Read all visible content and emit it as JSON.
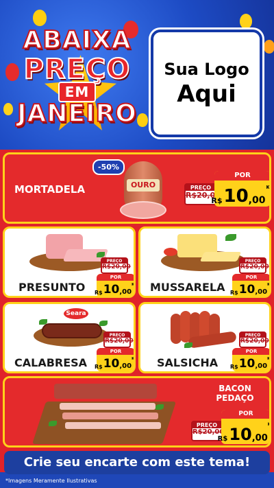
{
  "header": {
    "headline_1": "ABAIXA",
    "headline_2": "PREÇO",
    "headline_3": "EM",
    "headline_4": "JANEIRO",
    "logo_line_1": "Sua Logo",
    "logo_line_2": "Aqui"
  },
  "colors": {
    "brand_blue": "#1d4bc4",
    "brand_red": "#e42a2c",
    "brand_yellow": "#ffd21a"
  },
  "products": {
    "mortadela": {
      "name": "MORTADELA",
      "brand_on_pack": "OURO",
      "discount": "-50%",
      "old_label": "PREÇO",
      "old_price": "R$20,00",
      "new_label": "POR",
      "currency": "R$",
      "price_int": "10",
      "price_cents": ",00",
      "unit": "KG"
    },
    "presunto": {
      "name": "PRESUNTO",
      "old_label": "PREÇO",
      "old_price": "R$20,00",
      "new_label": "POR",
      "currency": "R$",
      "price_int": "10",
      "price_cents": ",00",
      "unit": "KG"
    },
    "mussarela": {
      "name": "MUSSARELA",
      "old_label": "PREÇO",
      "old_price": "R$20,00",
      "new_label": "POR",
      "currency": "R$",
      "price_int": "10",
      "price_cents": ",00",
      "unit": "KG"
    },
    "calabresa": {
      "name": "CALABRESA",
      "brand_on_pack": "Seara",
      "old_label": "PREÇO",
      "old_price": "R$20,00",
      "new_label": "POR",
      "currency": "R$",
      "price_int": "10",
      "price_cents": ",00",
      "unit": "KG"
    },
    "salsicha": {
      "name": "SALSICHA",
      "old_label": "PREÇO",
      "old_price": "R$20,00",
      "new_label": "POR",
      "currency": "R$",
      "price_int": "10",
      "price_cents": ",00",
      "unit": "KG"
    },
    "bacon": {
      "name_line_1": "BACON",
      "name_line_2": "PEDAÇO",
      "old_label": "PREÇO",
      "old_price": "R$20,00",
      "new_label": "POR",
      "currency": "R$",
      "price_int": "10",
      "price_cents": ",00",
      "unit": "KG"
    }
  },
  "footer": {
    "cta": "Crie seu encarte com este tema!",
    "disclaimer": "*Imagens Meramente Ilustrativas"
  }
}
